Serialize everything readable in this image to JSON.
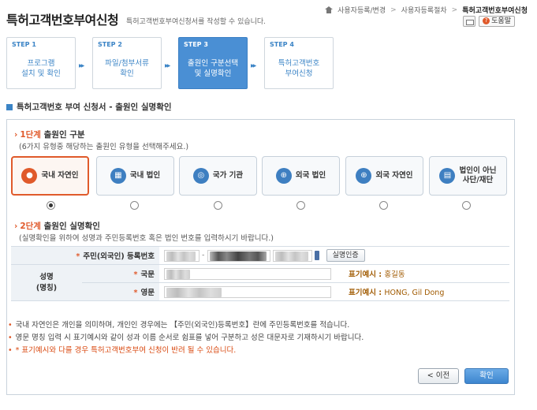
{
  "header": {
    "title": "특허고객번호부여신청",
    "description": "특허고객번호부여신청서를 작성할 수 있습니다.",
    "breadcrumb": [
      "사용자등록/변경",
      "사용자등록절차",
      "특허고객번호부여신청"
    ],
    "help_label": "도움말"
  },
  "steps": [
    {
      "num": "STEP 1",
      "label_1": "프로그램",
      "label_2": "설치 및 확인"
    },
    {
      "num": "STEP 2",
      "label_1": "파일/첨부서류",
      "label_2": "확인"
    },
    {
      "num": "STEP 3",
      "label_1": "출원인 구분선택",
      "label_2": "및 실명확인"
    },
    {
      "num": "STEP 4",
      "label_1": "특허고객번호",
      "label_2": "부여신청"
    }
  ],
  "section_title": "특허고객번호 부여 신청서 - 출원인 실명확인",
  "stage1": {
    "num": "1단계",
    "title": "출원인 구분",
    "desc": "(6가지 유형중 해당하는 출원인 유형을 선택해주세요.)"
  },
  "applicant_types": [
    {
      "label_1": "국내 자연인",
      "label_2": "",
      "icon": "person-icon",
      "selected": true
    },
    {
      "label_1": "국내 법인",
      "label_2": "",
      "icon": "building-icon",
      "selected": false
    },
    {
      "label_1": "국가 기관",
      "label_2": "",
      "icon": "emblem-icon",
      "selected": false
    },
    {
      "label_1": "외국 법인",
      "label_2": "",
      "icon": "globe-icon",
      "selected": false
    },
    {
      "label_1": "외국 자연인",
      "label_2": "",
      "icon": "globe-person-icon",
      "selected": false
    },
    {
      "label_1": "법인이 아닌",
      "label_2": "사단/재단",
      "icon": "buildings-icon",
      "selected": false
    }
  ],
  "stage2": {
    "num": "2단계",
    "title": "출원인 실명확인",
    "desc": "(실명확인을 위하여 성명과 주민등록번호 혹은 법인 번호를 입력하시기 바랍니다.)"
  },
  "form": {
    "id_label": "주민(외국인) 등록번호",
    "verify_button": "실명인증",
    "name_group_1": "성명",
    "name_group_2": "(명칭)",
    "korean_label": "국문",
    "english_label": "영문",
    "korean_sample_label": "표기예시 :",
    "korean_sample_value": "홍길동",
    "english_sample_label": "표기예시 :",
    "english_sample_value": "HONG, Gil Dong"
  },
  "notes": [
    "국내 자연인은 개인을 의미하며, 개인인 경우에는 【주민(외국인)등록번호】란에 주민등록번호를 적습니다.",
    "영문 명칭 입력 시 표기예시와 같이 성과 이름 순서로 쉼표를 넣어 구분하고 성은 대문자로 기재하시기 바랍니다.",
    "* 표기예시와 다를 경우 특허고객번호부여 신청이 반려 될 수 있습니다."
  ],
  "buttons": {
    "prev": "< 이전",
    "ok": "확인"
  },
  "colors": {
    "accent": "#e05a2b",
    "brand": "#3b84c6",
    "active_step": "#4a8fd4"
  }
}
